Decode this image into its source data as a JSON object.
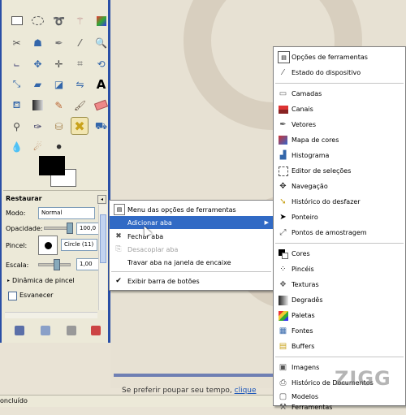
{
  "toolbox": {
    "options_title": "Restaurar",
    "mode_label": "Modo:",
    "mode_value": "Normal",
    "opacity_label": "Opacidade:",
    "opacity_value": "100,0",
    "brush_label": "Pincel:",
    "brush_value": "Circle (11)",
    "scale_label": "Escala:",
    "scale_value": "1,00",
    "dynamics_label": "Dinâmica de pincel",
    "fade_label": "Esvanecer"
  },
  "context_menu": {
    "items": [
      {
        "label": "Menu das opções de ferramentas",
        "icon": "tool-options-icon"
      },
      {
        "label": "Adicionar aba",
        "icon": "",
        "highlighted": true,
        "submenu": true
      },
      {
        "label": "Fechar aba",
        "icon": "close-icon"
      },
      {
        "label": "Desacoplar aba",
        "icon": "detach-icon",
        "disabled": true
      },
      {
        "label": "Travar aba na janela de encaixe",
        "icon": ""
      },
      {
        "label": "Exibir barra de botões",
        "icon": "checkmark-icon",
        "checked": true
      }
    ]
  },
  "submenu": {
    "items": [
      {
        "label": "Opções de ferramentas"
      },
      {
        "label": "Estado do dispositivo"
      },
      {
        "label": "Camadas"
      },
      {
        "label": "Canais"
      },
      {
        "label": "Vetores"
      },
      {
        "label": "Mapa de cores"
      },
      {
        "label": "Histograma"
      },
      {
        "label": "Editor de seleções"
      },
      {
        "label": "Navegação"
      },
      {
        "label": "Histórico do desfazer"
      },
      {
        "label": "Ponteiro"
      },
      {
        "label": "Pontos de amostragem"
      },
      {
        "label": "Cores"
      },
      {
        "label": "Pincéis"
      },
      {
        "label": "Texturas"
      },
      {
        "label": "Degradês"
      },
      {
        "label": "Paletas"
      },
      {
        "label": "Fontes"
      },
      {
        "label": "Buffers"
      },
      {
        "label": "Imagens"
      },
      {
        "label": "Histórico de Documentos"
      },
      {
        "label": "Modelos"
      },
      {
        "label": "Ferramentas"
      }
    ]
  },
  "page": {
    "caption_text": "Se preferir poupar seu tempo,",
    "caption_link": "clique",
    "status_text": "oncluído",
    "watermark": "ZIGG"
  },
  "colors": {
    "highlight": "#316ac5",
    "toolbox_border": "#2a4fa6"
  }
}
